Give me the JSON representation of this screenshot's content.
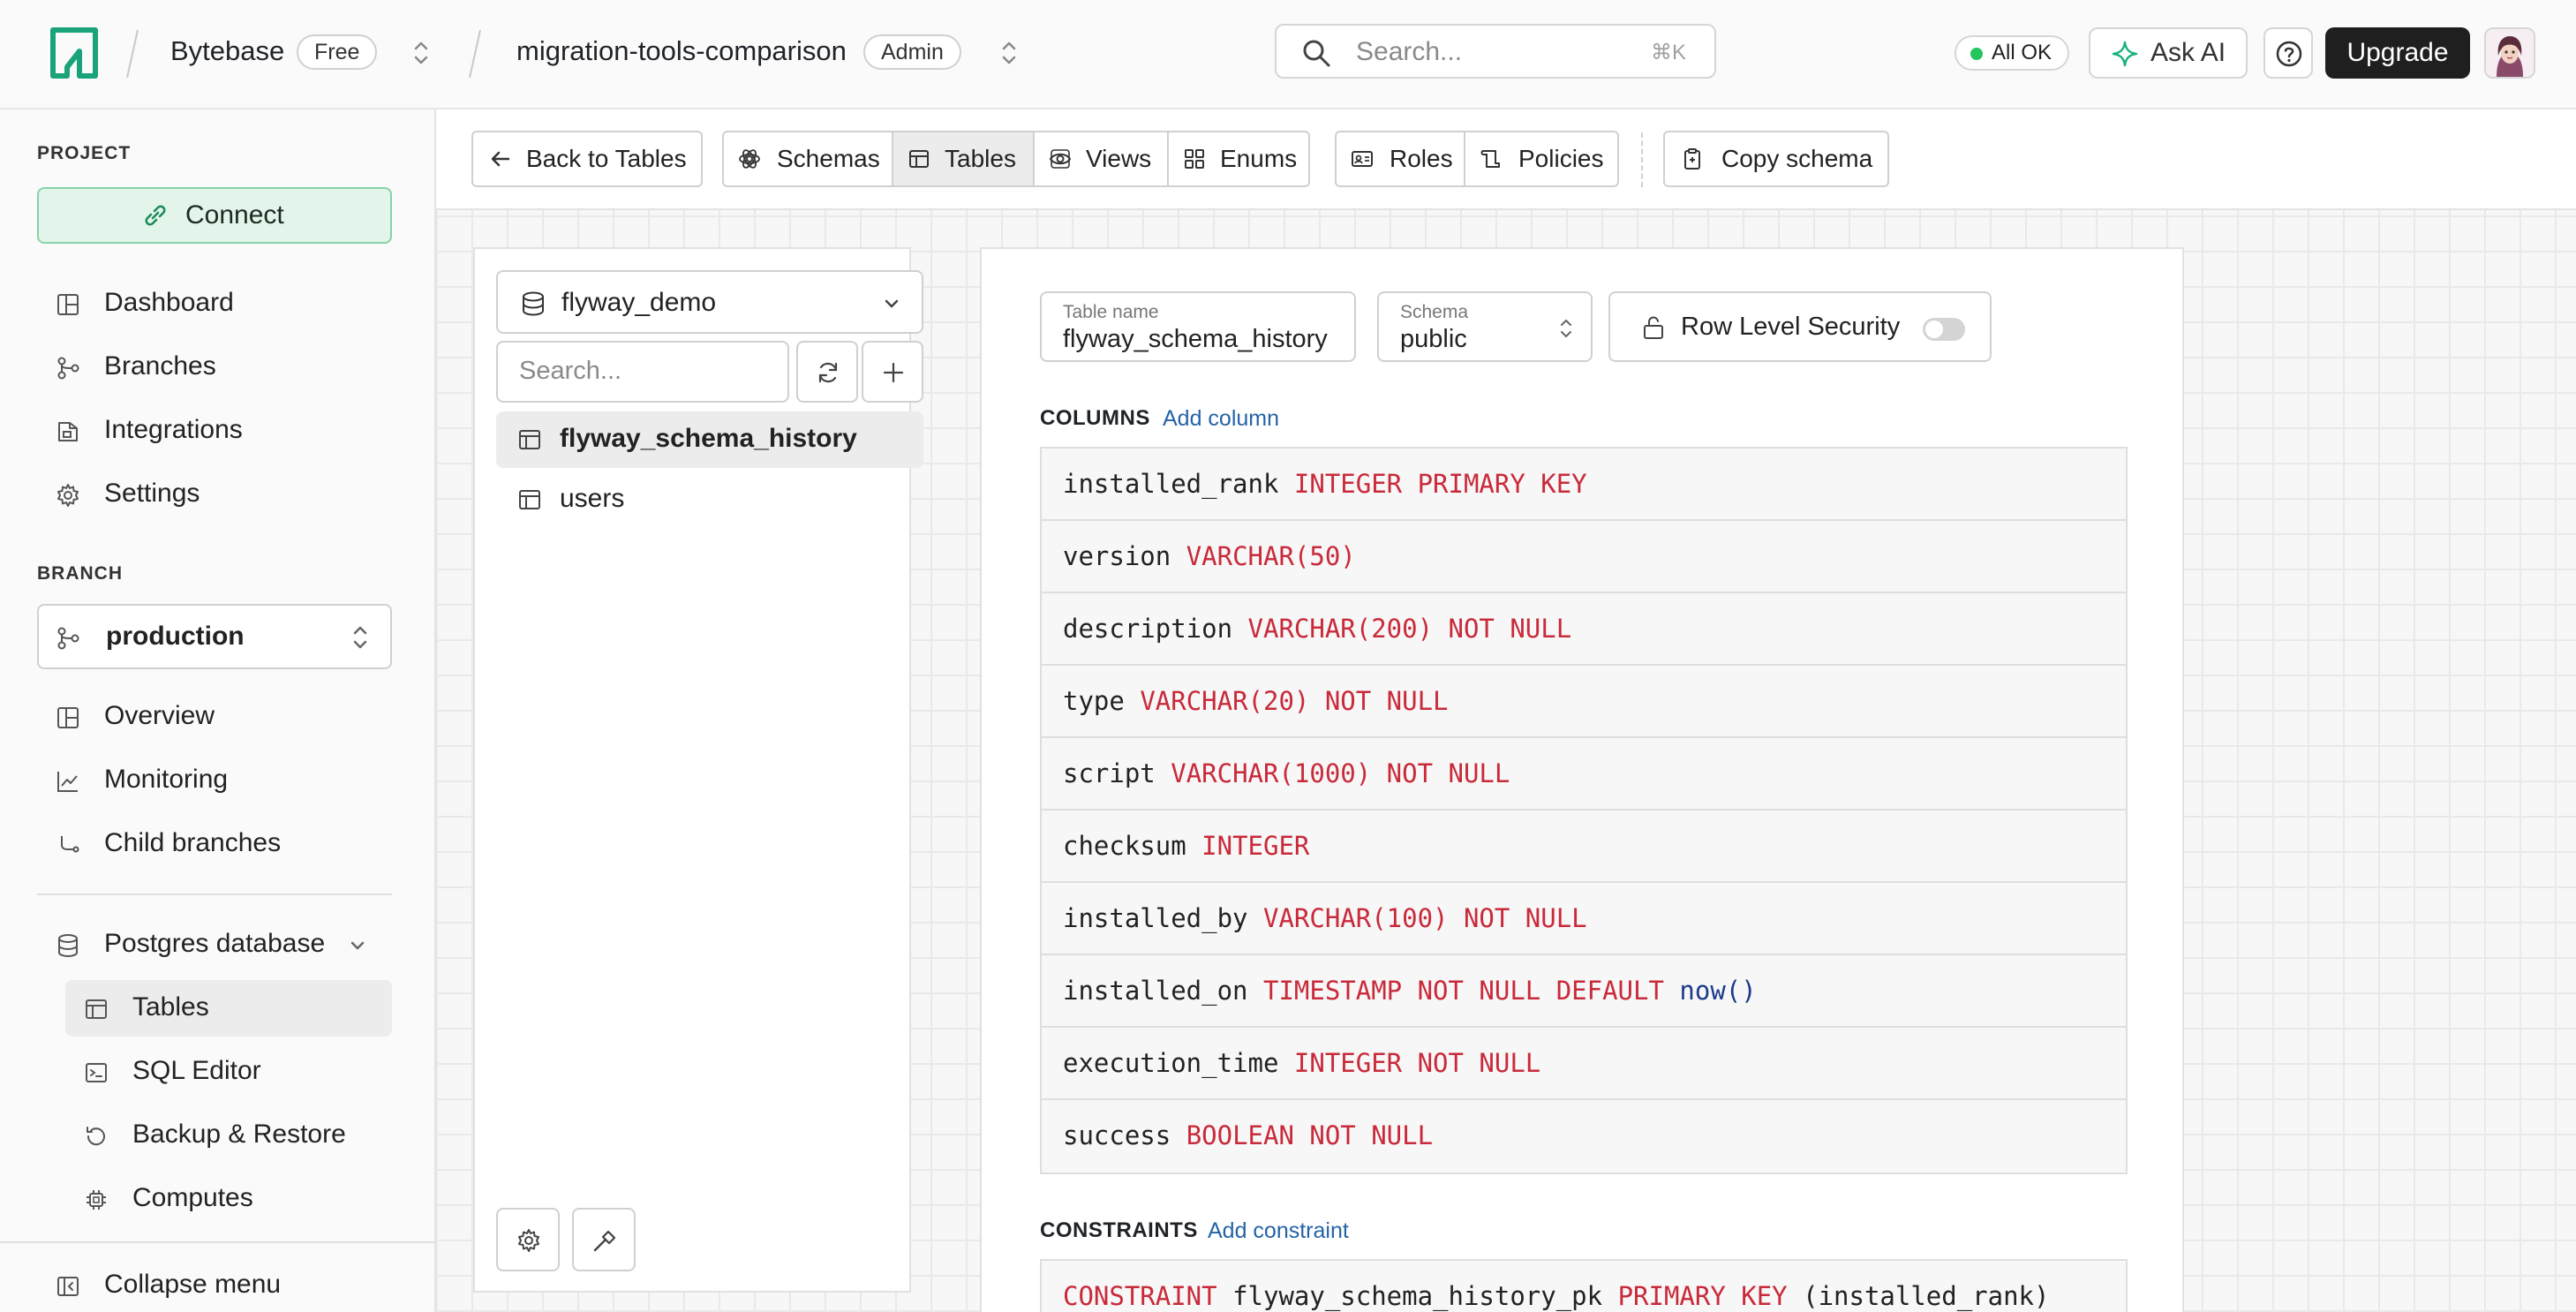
{
  "topbar": {
    "org_name": "Bytebase",
    "plan_badge": "Free",
    "project_name": "migration-tools-comparison",
    "role_badge": "Admin",
    "search_placeholder": "Search...",
    "search_shortcut": "⌘K",
    "status_label": "All OK",
    "status_color": "#22c55e",
    "ask_ai_label": "Ask AI",
    "upgrade_label": "Upgrade",
    "icons": [
      "logo-icon",
      "search-icon",
      "sparkle-icon",
      "help-icon",
      "avatar"
    ]
  },
  "sidebar": {
    "project_label": "PROJECT",
    "connect_label": "Connect",
    "project_items": [
      {
        "label": "Dashboard",
        "icon": "dashboard-icon"
      },
      {
        "label": "Branches",
        "icon": "branches-icon"
      },
      {
        "label": "Integrations",
        "icon": "integrations-icon"
      },
      {
        "label": "Settings",
        "icon": "gear-icon"
      }
    ],
    "branch_label": "BRANCH",
    "branch_value": "production",
    "branch_items": [
      {
        "label": "Overview",
        "icon": "overview-icon"
      },
      {
        "label": "Monitoring",
        "icon": "monitoring-icon"
      },
      {
        "label": "Child branches",
        "icon": "child-branch-icon"
      }
    ],
    "database_label": "Postgres database",
    "database_items": [
      {
        "label": "Tables",
        "icon": "table-icon",
        "active": true
      },
      {
        "label": "SQL Editor",
        "icon": "sql-editor-icon"
      },
      {
        "label": "Backup & Restore",
        "icon": "restore-icon"
      },
      {
        "label": "Computes",
        "icon": "chip-icon"
      }
    ],
    "collapse_label": "Collapse menu"
  },
  "toolbar": {
    "back_label": "Back to Tables",
    "tabs": [
      {
        "label": "Schemas",
        "icon": "schema-icon"
      },
      {
        "label": "Tables",
        "icon": "table-icon",
        "active": true
      },
      {
        "label": "Views",
        "icon": "eye-icon"
      },
      {
        "label": "Enums",
        "icon": "grid-icon"
      }
    ],
    "roles_label": "Roles",
    "policies_label": "Policies",
    "copy_schema_label": "Copy schema"
  },
  "tables_panel": {
    "database": "flyway_demo",
    "search_placeholder": "Search...",
    "tables": [
      {
        "name": "flyway_schema_history",
        "active": true
      },
      {
        "name": "users",
        "active": false
      }
    ]
  },
  "editor": {
    "table_name_label": "Table name",
    "table_name": "flyway_schema_history",
    "schema_label": "Schema",
    "schema_value": "public",
    "rls_label": "Row Level Security",
    "rls_enabled": false,
    "columns_title": "COLUMNS",
    "add_column_label": "Add column",
    "columns": [
      {
        "name": "installed_rank",
        "type": "INTEGER PRIMARY KEY",
        "default": ""
      },
      {
        "name": "version",
        "type": "VARCHAR(50)",
        "default": ""
      },
      {
        "name": "description",
        "type": "VARCHAR(200) NOT NULL",
        "default": ""
      },
      {
        "name": "type",
        "type": "VARCHAR(20) NOT NULL",
        "default": ""
      },
      {
        "name": "script",
        "type": "VARCHAR(1000) NOT NULL",
        "default": ""
      },
      {
        "name": "checksum",
        "type": "INTEGER",
        "default": ""
      },
      {
        "name": "installed_by",
        "type": "VARCHAR(100) NOT NULL",
        "default": ""
      },
      {
        "name": "installed_on",
        "type": "TIMESTAMP NOT NULL DEFAULT",
        "default": "now()"
      },
      {
        "name": "execution_time",
        "type": "INTEGER NOT NULL",
        "default": ""
      },
      {
        "name": "success",
        "type": "BOOLEAN NOT NULL",
        "default": ""
      }
    ],
    "constraints_title": "CONSTRAINTS",
    "add_constraint_label": "Add constraint",
    "constraints": [
      {
        "keyword": "CONSTRAINT",
        "name": "flyway_schema_history_pk",
        "type": "PRIMARY KEY",
        "columns": "(installed_rank)"
      }
    ]
  },
  "colors": {
    "sql_keyword": "#c92a3a",
    "sql_function": "#1d3a8a",
    "link": "#2563a6",
    "connect_bg": "#e3f5ea",
    "brand_green": "#1aa37a"
  }
}
